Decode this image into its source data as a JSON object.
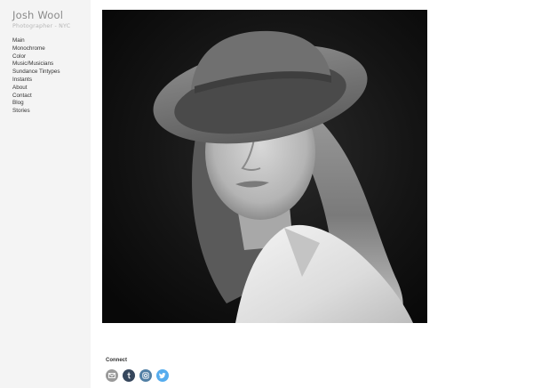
{
  "site": {
    "title": "Josh Wool",
    "subtitle": "Photographer - NYC"
  },
  "nav": {
    "items": [
      {
        "label": "Main"
      },
      {
        "label": "Monochrome"
      },
      {
        "label": "Color"
      },
      {
        "label": "Music/Musicians"
      },
      {
        "label": "Sundance Tintypes"
      },
      {
        "label": "Instants"
      },
      {
        "label": "About"
      },
      {
        "label": "Contact"
      },
      {
        "label": "Blog"
      },
      {
        "label": "Stories"
      }
    ]
  },
  "footer": {
    "connect_label": "Connect",
    "social": [
      {
        "icon": "mail-icon",
        "color": "#9a9a9a"
      },
      {
        "icon": "tumblr-icon",
        "color": "#35465c"
      },
      {
        "icon": "instagram-icon",
        "color": "#517fa4"
      },
      {
        "icon": "twitter-icon",
        "color": "#55acee"
      }
    ]
  },
  "colors": {
    "sidebar_bg": "#f4f4f4",
    "title": "#8a8a8a",
    "subtitle": "#b6b6b6",
    "nav_text": "#333333"
  }
}
